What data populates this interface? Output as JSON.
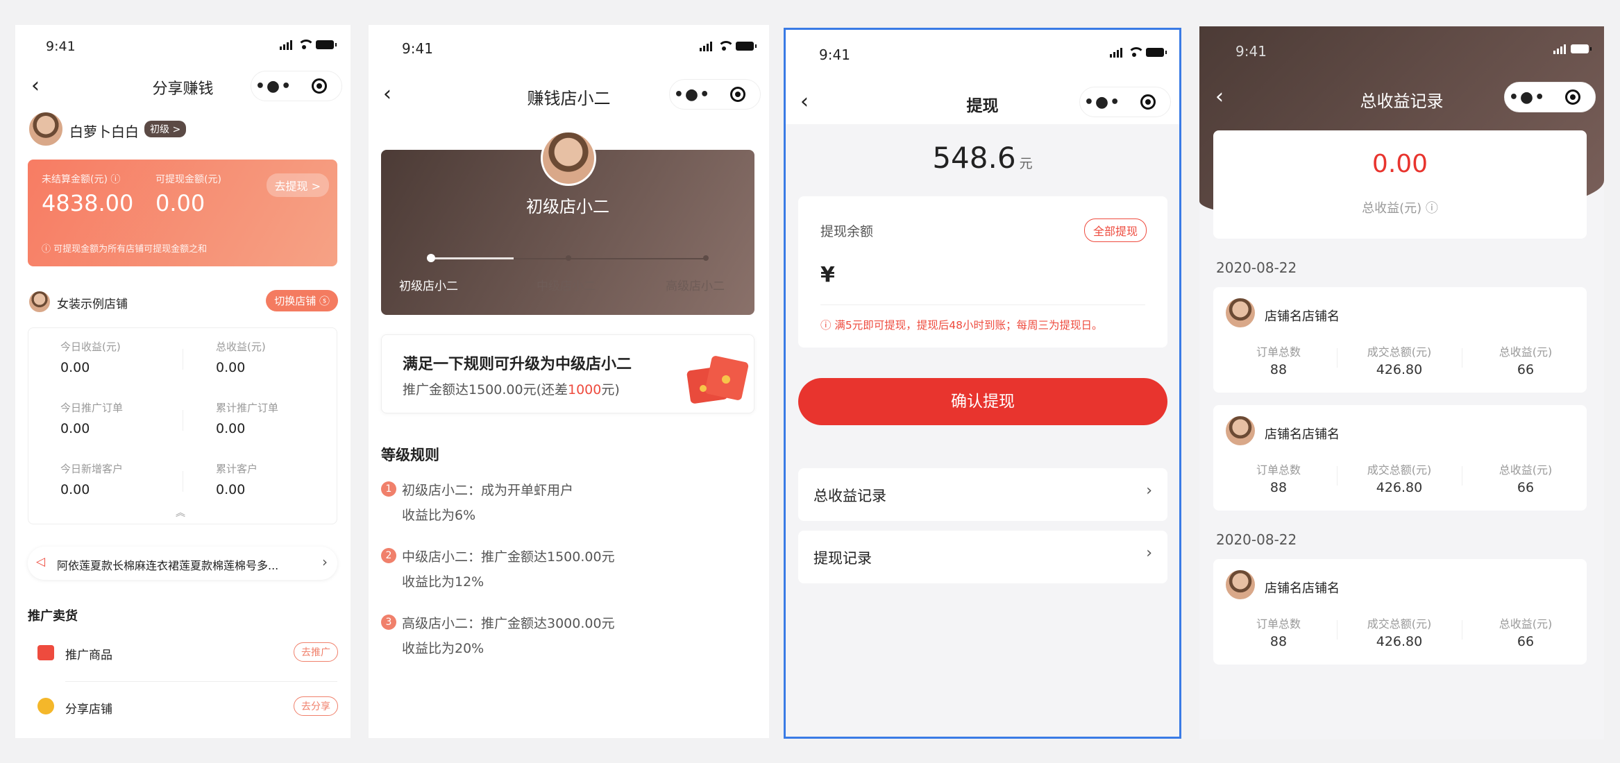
{
  "status_time": "9:41",
  "screen1": {
    "title": "分享赚钱",
    "user_name": "白萝卜白白",
    "level_badge": "初级 >",
    "unsettled_label": "未结算金额(元) ⓘ",
    "unsettled_value": "4838.00",
    "withdrawable_label": "可提现金额(元)",
    "withdrawable_value": "0.00",
    "withdraw_btn": "去提现 >",
    "note": "ⓘ 可提现金额为所有店铺可提现金额之和",
    "shop_name": "女装示例店铺",
    "switch_shop": "切换店铺 ⓢ",
    "stats": [
      {
        "label": "今日收益(元)",
        "value": "0.00"
      },
      {
        "label": "总收益(元)",
        "value": "0.00"
      },
      {
        "label": "今日推广订单",
        "value": "0.00"
      },
      {
        "label": "累计推广订单",
        "value": "0.00"
      },
      {
        "label": "今日新增客户",
        "value": "0.00"
      },
      {
        "label": "累计客户",
        "value": "0.00"
      }
    ],
    "collapse": "︽",
    "notice": "阿依莲夏款长棉麻连衣裙莲夏款棉莲棉号多...",
    "section_title": "推广卖货",
    "promote_goods": "推广商品",
    "promote_goods_btn": "去推广",
    "share_shop": "分享店铺",
    "share_shop_btn": "去分享"
  },
  "screen2": {
    "title": "赚钱店小二",
    "level_title": "初级店小二",
    "levels": [
      "初级店小二",
      "中级店小二",
      "高级店小二"
    ],
    "progress": 0.3,
    "upgrade_title": "满足一下规则可升级为中级店小二",
    "upgrade_desc_prefix": "推广金额达1500.00元(还差",
    "upgrade_desc_highlight": "1000",
    "upgrade_desc_suffix": "元)",
    "rules_title": "等级规则",
    "rules": [
      {
        "num": "1",
        "line1": "初级店小二：成为开单虾用户",
        "line2": "收益比为6%"
      },
      {
        "num": "2",
        "line1": "中级店小二：推广金额达1500.00元",
        "line2": "收益比为12%"
      },
      {
        "num": "3",
        "line1": "高级店小二：推广金额达3000.00元",
        "line2": "收益比为20%"
      }
    ]
  },
  "screen3": {
    "title": "提现",
    "amount": "548.6",
    "unit": "元",
    "balance_label": "提现余额",
    "all_btn": "全部提现",
    "currency": "¥",
    "tip": "ⓘ 满5元即可提现，提现后48小时到账；每周三为提现日。",
    "confirm": "确认提现",
    "menu": [
      "总收益记录",
      "提现记录"
    ]
  },
  "screen4": {
    "title": "总收益记录",
    "total": "0.00",
    "total_label": "总收益(元) ⓘ",
    "groups": [
      {
        "date": "2020-08-22",
        "items": [
          {
            "shop": "店铺名店铺名",
            "orders_label": "订单总数",
            "orders": "88",
            "amount_label": "成交总额(元)",
            "amount": "426.80",
            "income_label": "总收益(元)",
            "income": "66"
          },
          {
            "shop": "店铺名店铺名",
            "orders_label": "订单总数",
            "orders": "88",
            "amount_label": "成交总额(元)",
            "amount": "426.80",
            "income_label": "总收益(元)",
            "income": "66"
          }
        ]
      },
      {
        "date": "2020-08-22",
        "items": [
          {
            "shop": "店铺名店铺名",
            "orders_label": "订单总数",
            "orders": "88",
            "amount_label": "成交总额(元)",
            "amount": "426.80",
            "income_label": "总收益(元)",
            "income": "66"
          }
        ]
      }
    ]
  }
}
